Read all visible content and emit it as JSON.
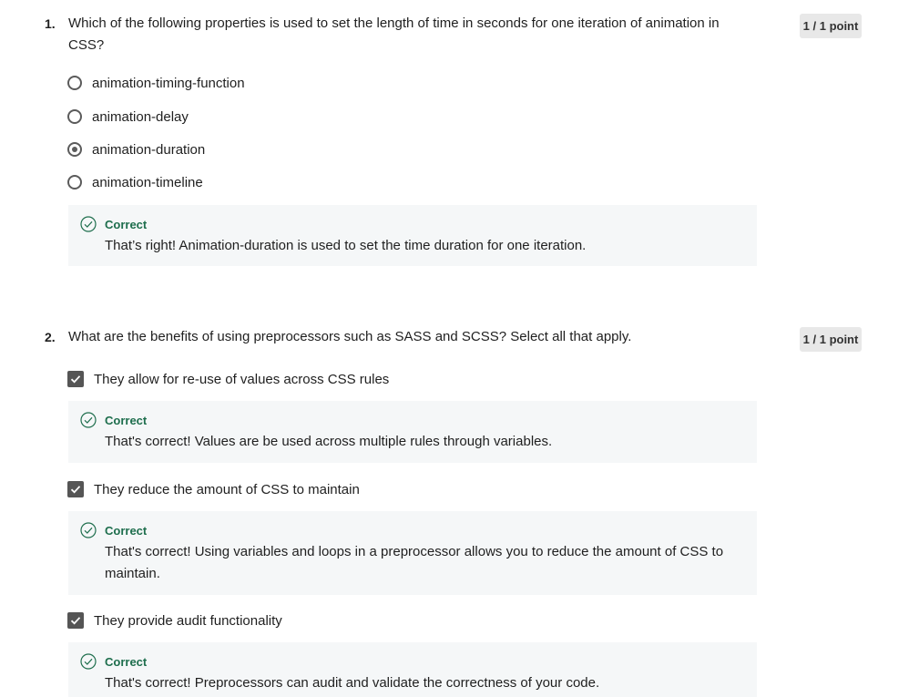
{
  "questions": [
    {
      "number": "1.",
      "text": "Which of the following properties is used to set the length of time in seconds for one iteration of animation in CSS?",
      "points": "1 / 1 point",
      "options": [
        {
          "label": "animation-timing-function",
          "selected": false
        },
        {
          "label": "animation-delay",
          "selected": false
        },
        {
          "label": "animation-duration",
          "selected": true
        },
        {
          "label": "animation-timeline",
          "selected": false
        }
      ],
      "feedback": {
        "title": "Correct",
        "text": "That’s right! Animation-duration is used to set the time duration for one iteration."
      }
    },
    {
      "number": "2.",
      "text": "What are the benefits of using preprocessors such as SASS and SCSS? Select all that apply.",
      "points": "1 / 1 point",
      "options": [
        {
          "label": "They allow for re-use of values across CSS rules",
          "checked": true,
          "feedback": {
            "title": "Correct",
            "text": "That's correct! Values are be used across multiple rules through variables."
          }
        },
        {
          "label": "They reduce the amount of CSS to maintain",
          "checked": true,
          "feedback": {
            "title": "Correct",
            "text": "That's correct! Using variables and loops in a preprocessor allows you to reduce the amount of CSS to maintain."
          }
        },
        {
          "label": "They provide audit functionality",
          "checked": true,
          "feedback": {
            "title": "Correct",
            "text": "That's correct! Preprocessors can audit and validate the correctness of your code."
          }
        }
      ]
    }
  ],
  "colors": {
    "correct_green": "#1e6e4d",
    "feedback_bg": "#f5f7f8",
    "points_bg": "#e8e8e8",
    "control_gray": "#555555"
  },
  "icons": {
    "feedback": "check-circle-icon",
    "checkbox": "checkmark-icon"
  }
}
